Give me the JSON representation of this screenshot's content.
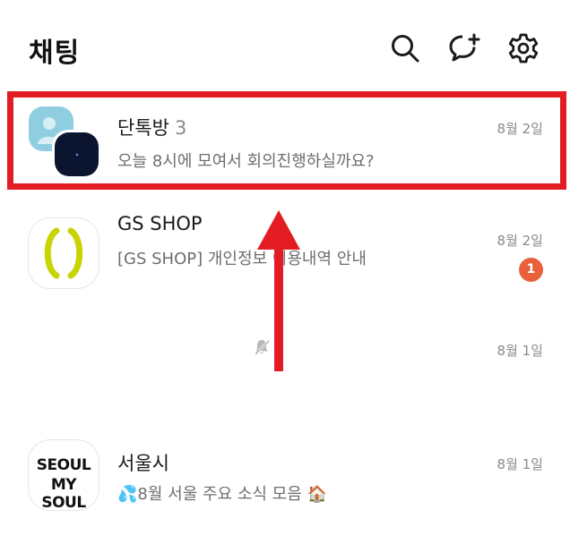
{
  "header": {
    "title": "채팅",
    "icons": [
      "search-icon",
      "new-chat-icon",
      "settings-icon"
    ]
  },
  "chats": [
    {
      "name": "단톡방",
      "count": "3",
      "preview": "오늘 8시에 모여서 회의진행하실까요?",
      "time": "8월 2일"
    },
    {
      "name": "GS SHOP",
      "preview": "[GS SHOP] 개인정보 이용내역 안내",
      "time": "8월 2일",
      "unread": "1"
    },
    {
      "name": "",
      "preview": "",
      "time": "8월 1일",
      "muted": true
    },
    {
      "name": "서울시",
      "preview": "💦8월 서울 주요 소식 모음 🏠",
      "time": "8월 1일",
      "logo_text": [
        "SEOUL",
        "MY SOUL"
      ]
    }
  ],
  "colors": {
    "highlight": "#e31c23",
    "badge": "#e8603c",
    "gs_logo": "#c8d400"
  }
}
